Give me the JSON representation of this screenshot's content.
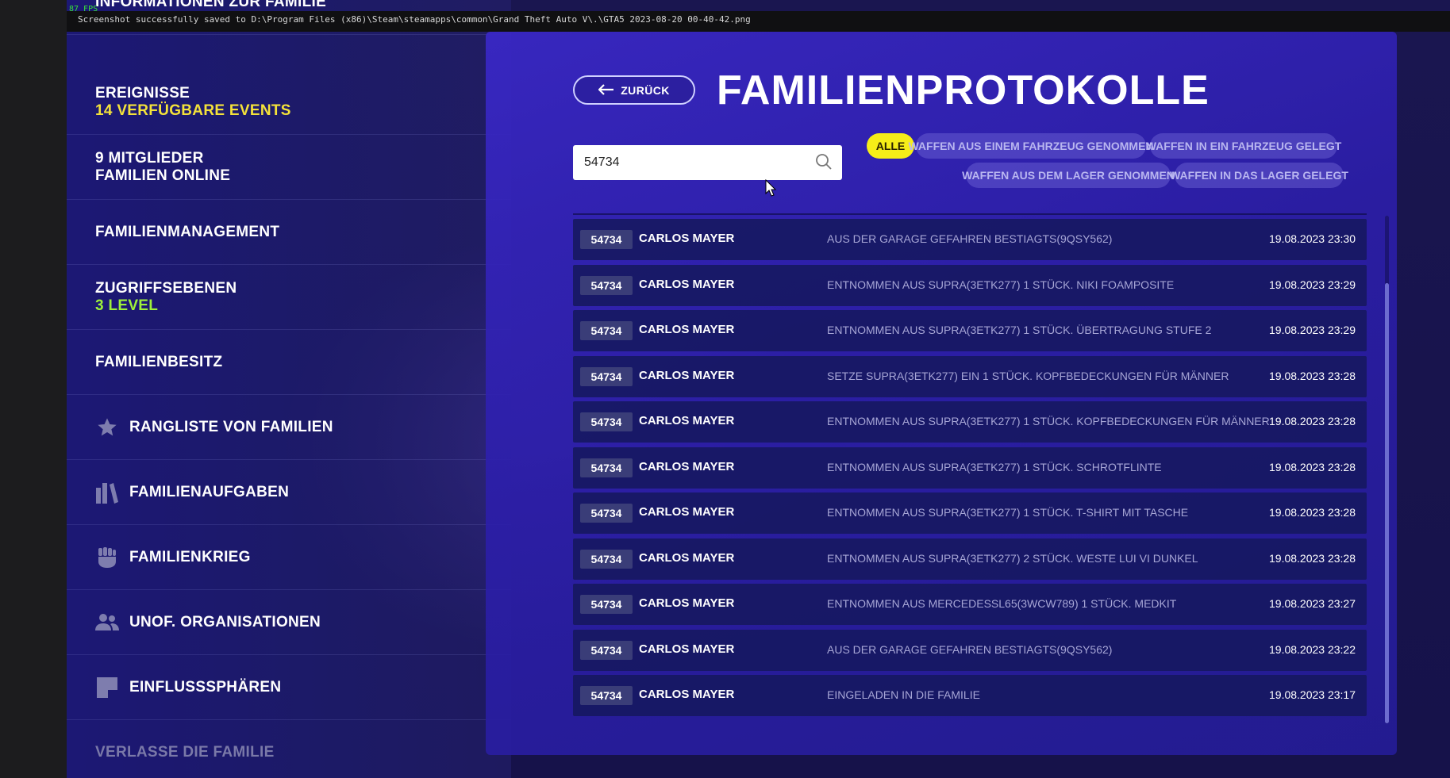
{
  "overlay": {
    "fps": "87 FPS",
    "screenshot_message": "Screenshot successfully saved to D:\\Program Files (x86)\\Steam\\steamapps\\common\\Grand Theft Auto V\\.\\GTA5 2023-08-20 00-40-42.png"
  },
  "sidebar": {
    "info": {
      "title": "INFORMATIONEN ZUR FAMILIE"
    },
    "events": {
      "title": "EREIGNISSE",
      "sub": "14 VERFÜGBARE EVENTS",
      "sub_color": "#f4e23a"
    },
    "members": {
      "title": "9 MITGLIEDER",
      "sub": "FAMILIEN ONLINE",
      "sub_color": "#ffffff"
    },
    "management": {
      "title": "FAMILIENMANAGEMENT"
    },
    "access": {
      "title": "ZUGRIFFSEBENEN",
      "sub": "3 LEVEL",
      "sub_color": "#9ef23a"
    },
    "property": {
      "title": "FAMILIENBESITZ"
    },
    "ranking": {
      "title": "RANGLISTE VON FAMILIEN",
      "icon": "star-icon"
    },
    "tasks": {
      "title": "FAMILIENAUFGABEN",
      "icon": "books-icon"
    },
    "war": {
      "title": "FAMILIENKRIEG",
      "icon": "fist-icon"
    },
    "orgs": {
      "title": "UNOF. ORGANISATIONEN",
      "icon": "people-icon"
    },
    "spheres": {
      "title": "EINFLUSSSPHÄREN",
      "icon": "flag-icon"
    },
    "leave": {
      "title": "VERLASSE DIE FAMILIE"
    }
  },
  "panel": {
    "back_label": "ZURÜCK",
    "title": "FAMILIENPROTOKOLLE",
    "search": {
      "value": "54734",
      "placeholder": ""
    },
    "filters": [
      {
        "label": "ALLE",
        "active": true
      },
      {
        "label": "WAFFEN AUS EINEM FAHRZEUG GENOMMEN",
        "active": false
      },
      {
        "label": "WAFFEN IN EIN FAHRZEUG GELEGT",
        "active": false
      },
      {
        "label": "WAFFEN AUS DEM LAGER GENOMMEN",
        "active": false
      },
      {
        "label": "WAFFEN IN DAS LAGER GELEGT",
        "active": false
      }
    ],
    "logs": [
      {
        "id": "54734",
        "name": "CARLOS MAYER",
        "action": "AUS DER GARAGE GEFAHREN BESTIAGTS(9QSY562)",
        "time": "19.08.2023 23:30"
      },
      {
        "id": "54734",
        "name": "CARLOS MAYER",
        "action": "ENTNOMMEN AUS SUPRA(3ETK277) 1 STÜCK. NIKI FOAMPOSITE",
        "time": "19.08.2023 23:29"
      },
      {
        "id": "54734",
        "name": "CARLOS MAYER",
        "action": "ENTNOMMEN AUS SUPRA(3ETK277) 1 STÜCK. ÜBERTRAGUNG STUFE 2",
        "time": "19.08.2023 23:29"
      },
      {
        "id": "54734",
        "name": "CARLOS MAYER",
        "action": "SETZE SUPRA(3ETK277) EIN 1 STÜCK. KOPFBEDECKUNGEN FÜR MÄNNER",
        "time": "19.08.2023 23:28"
      },
      {
        "id": "54734",
        "name": "CARLOS MAYER",
        "action": "ENTNOMMEN AUS SUPRA(3ETK277) 1 STÜCK. KOPFBEDECKUNGEN FÜR MÄNNER",
        "time": "19.08.2023 23:28"
      },
      {
        "id": "54734",
        "name": "CARLOS MAYER",
        "action": "ENTNOMMEN AUS SUPRA(3ETK277) 1 STÜCK. SCHROTFLINTE",
        "time": "19.08.2023 23:28"
      },
      {
        "id": "54734",
        "name": "CARLOS MAYER",
        "action": "ENTNOMMEN AUS SUPRA(3ETK277) 1 STÜCK. T-SHIRT MIT TASCHE",
        "time": "19.08.2023 23:28"
      },
      {
        "id": "54734",
        "name": "CARLOS MAYER",
        "action": "ENTNOMMEN AUS SUPRA(3ETK277) 2 STÜCK. WESTE LUI VI DUNKEL",
        "time": "19.08.2023 23:28"
      },
      {
        "id": "54734",
        "name": "CARLOS MAYER",
        "action": "ENTNOMMEN AUS MERCEDESSL65(3WCW789) 1 STÜCK. MEDKIT",
        "time": "19.08.2023 23:27"
      },
      {
        "id": "54734",
        "name": "CARLOS MAYER",
        "action": "AUS DER GARAGE GEFAHREN BESTIAGTS(9QSY562)",
        "time": "19.08.2023 23:22"
      },
      {
        "id": "54734",
        "name": "CARLOS MAYER",
        "action": "EINGELADEN IN DIE FAMILIE",
        "time": "19.08.2023 23:17"
      }
    ]
  },
  "colors": {
    "accent_yellow": "#f6ee18",
    "panel_bg": "#3a28c8",
    "row_bg": "#16185f"
  }
}
